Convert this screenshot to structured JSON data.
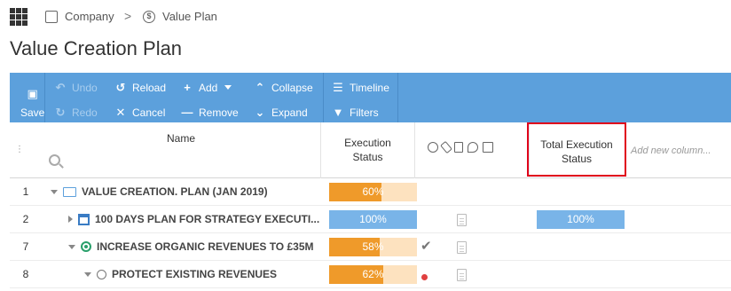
{
  "breadcrumb": {
    "company": "Company",
    "separator": ">",
    "plan": "Value Plan",
    "company_icon": "company-icon",
    "plan_icon": "dollar-circle-icon"
  },
  "page": {
    "title": "Value Creation Plan"
  },
  "toolbar": {
    "save": "Save",
    "undo": "Undo",
    "redo": "Redo",
    "reload": "Reload",
    "cancel": "Cancel",
    "add": "Add",
    "remove": "Remove",
    "collapse": "Collapse",
    "expand": "Expand",
    "timeline": "Timeline",
    "filters": "Filters",
    "bg_color": "#5ca0dc"
  },
  "columns": {
    "name": "Name",
    "execution_status_1": "Execution",
    "execution_status_2": "Status",
    "total_1": "Total Execution",
    "total_2": "Status",
    "add_new": "Add new column..."
  },
  "rows": [
    {
      "num": "1",
      "name": "VALUE CREATION. PLAN (JAN 2019)",
      "exec": "60%",
      "exec_value": 0.6
    },
    {
      "num": "2",
      "name": "100 DAYS PLAN FOR STRATEGY EXECUTI...",
      "exec": "100%",
      "exec_value": 1.0,
      "total": "100%"
    },
    {
      "num": "7",
      "name": "INCREASE ORGANIC REVENUES TO £35M",
      "exec": "58%",
      "exec_value": 0.58
    },
    {
      "num": "8",
      "name": "PROTECT EXISTING REVENUES",
      "exec": "62%",
      "exec_value": 0.62
    }
  ],
  "colors": {
    "orange": "#ef9a2a",
    "light_orange": "#fde2bf",
    "blue": "#79b4e8",
    "highlight": "#e0001b"
  }
}
